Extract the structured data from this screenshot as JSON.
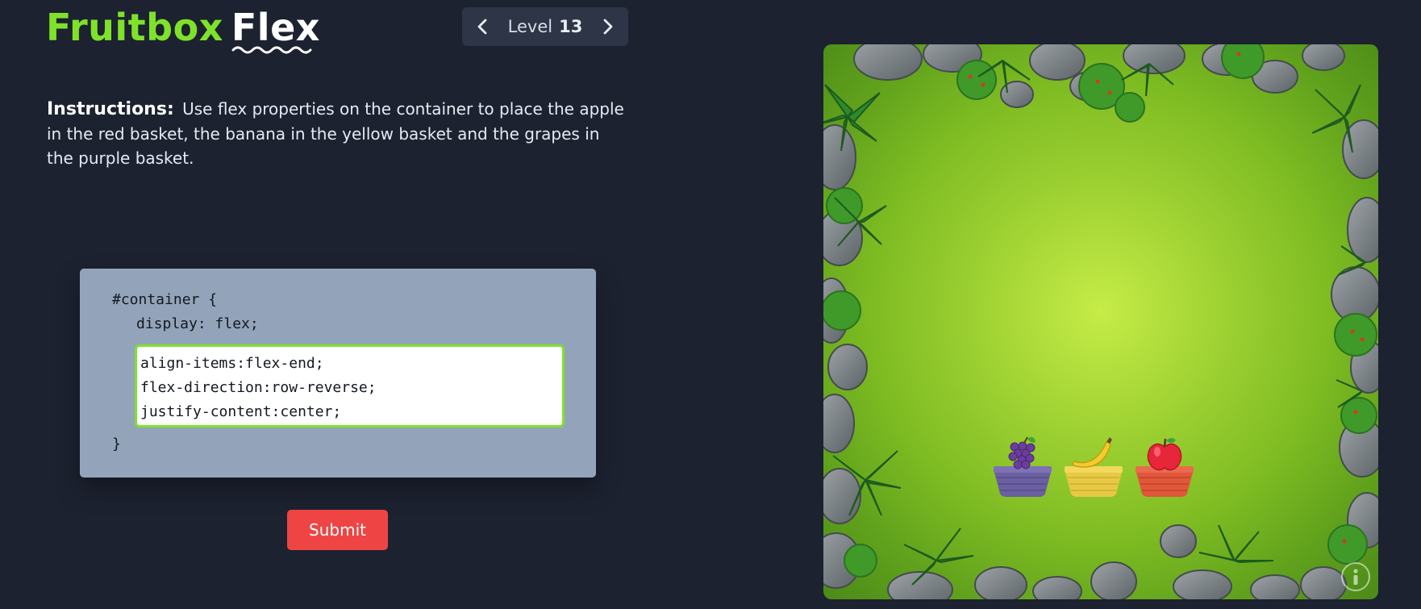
{
  "logo": {
    "part1": "Fruitbox",
    "part2": "Flex"
  },
  "level_nav": {
    "label": "Level",
    "number": "13",
    "prev_icon": "chevron-left-icon",
    "next_icon": "chevron-right-icon"
  },
  "instructions": {
    "lead": "Instructions:",
    "text": "Use flex properties on the container to place the apple in the red basket, the banana in the yellow basket and the grapes in the purple basket."
  },
  "editor": {
    "line1": "#container {",
    "line2": "display: flex;",
    "input_lines": [
      "align-items:flex-end;",
      "flex-direction:row-reverse;",
      "justify-content:center;"
    ],
    "closing": "}"
  },
  "submit_label": "Submit",
  "board": {
    "baskets": [
      {
        "color": "#6a5fa0",
        "fruit": "grapes"
      },
      {
        "color": "#e8c945",
        "fruit": "banana"
      },
      {
        "color": "#e0573b",
        "fruit": "apple"
      }
    ],
    "info_icon": "info-icon"
  },
  "colors": {
    "background": "#1c2230",
    "accent_green": "#7fe22a",
    "submit_red": "#ef4444",
    "editor_bg": "#93a4ba"
  }
}
